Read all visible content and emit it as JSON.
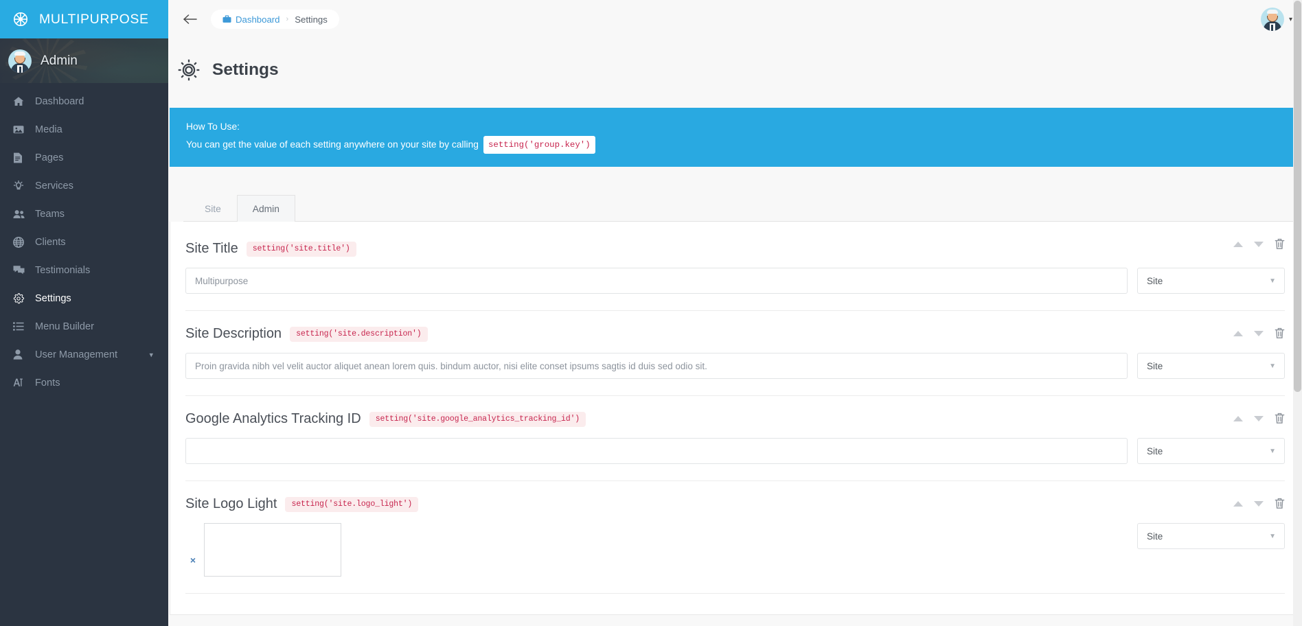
{
  "brand": {
    "title": "MULTIPURPOSE",
    "icon": "ship-wheel-icon"
  },
  "profile": {
    "name": "Admin",
    "avatar_icon": "user-avatar"
  },
  "sidebar": {
    "items": [
      {
        "label": "Dashboard",
        "icon": "home-icon",
        "active": false,
        "has_caret": false
      },
      {
        "label": "Media",
        "icon": "image-icon",
        "active": false,
        "has_caret": false
      },
      {
        "label": "Pages",
        "icon": "file-icon",
        "active": false,
        "has_caret": false
      },
      {
        "label": "Services",
        "icon": "lightbulb-icon",
        "active": false,
        "has_caret": false
      },
      {
        "label": "Teams",
        "icon": "users-icon",
        "active": false,
        "has_caret": false
      },
      {
        "label": "Clients",
        "icon": "globe-icon",
        "active": false,
        "has_caret": false
      },
      {
        "label": "Testimonials",
        "icon": "comments-icon",
        "active": false,
        "has_caret": false
      },
      {
        "label": "Settings",
        "icon": "gear-icon",
        "active": true,
        "has_caret": false
      },
      {
        "label": "Menu Builder",
        "icon": "list-icon",
        "active": false,
        "has_caret": false
      },
      {
        "label": "User Management",
        "icon": "user-icon",
        "active": false,
        "has_caret": true
      },
      {
        "label": "Fonts",
        "icon": "font-icon",
        "active": false,
        "has_caret": false
      }
    ]
  },
  "topbar": {
    "back_icon": "arrow-left-icon",
    "breadcrumb": {
      "home_icon": "briefcase-icon",
      "home_label": "Dashboard",
      "separator": "›",
      "current": "Settings"
    },
    "user_caret": "▾"
  },
  "page": {
    "title": "Settings",
    "icon": "gear-icon"
  },
  "howto": {
    "title": "How To Use:",
    "body": "You can get the value of each setting anywhere on your site by calling",
    "code": "setting('group.key')",
    "bg_color": "#29a9e1"
  },
  "tabs": [
    {
      "label": "Site",
      "state": "active"
    },
    {
      "label": "Admin",
      "state": "inactive"
    }
  ],
  "settings": [
    {
      "label": "Site Title",
      "key": "setting('site.title')",
      "type": "text",
      "value": "Multipurpose",
      "group": "Site"
    },
    {
      "label": "Site Description",
      "key": "setting('site.description')",
      "type": "text",
      "value": "Proin gravida nibh vel velit auctor aliquet anean lorem quis. bindum auctor, nisi elite conset ipsums sagtis id duis sed odio sit.",
      "group": "Site"
    },
    {
      "label": "Google Analytics Tracking ID",
      "key": "setting('site.google_analytics_tracking_id')",
      "type": "text",
      "value": "",
      "group": "Site"
    },
    {
      "label": "Site Logo Light",
      "key": "setting('site.logo_light')",
      "type": "image",
      "remove_label": "×",
      "group": "Site"
    }
  ],
  "row_actions": {
    "move_up": "move-up",
    "move_down": "move-down",
    "delete": "delete"
  },
  "colors": {
    "brand_blue": "#29ABE2",
    "sidebar_dark": "#2b3441",
    "info_blue": "#29a9e1",
    "code_red": "#c7254e",
    "link_blue": "#3d99d8"
  }
}
